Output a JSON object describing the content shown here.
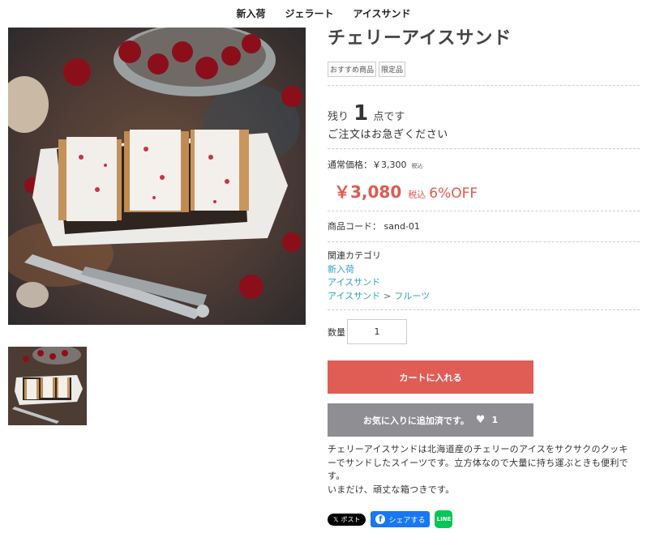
{
  "nav": {
    "items": [
      "新入荷",
      "ジェラート",
      "アイスサンド"
    ]
  },
  "product": {
    "title": "チェリーアイスサンド",
    "badges": [
      "おすすめ商品",
      "限定品"
    ],
    "stock_prefix": "残り",
    "stock_num": "1",
    "stock_suffix": "点です",
    "hurry": "ご注文はお急ぎください",
    "regular_price": "通常価格：￥3,300",
    "regular_tax": "税込",
    "sale_price": "￥3,080",
    "sale_tax": "税込",
    "discount": "6%OFF",
    "code": "商品コード： sand-01",
    "categories_label": "関連カテゴリ",
    "categories": [
      "新入荷",
      "アイスサンド"
    ],
    "category_path": [
      "アイスサンド",
      ">",
      "フルーツ"
    ],
    "qty_label": "数量",
    "qty_value": "1",
    "cart_button": "カートに入れる",
    "fav_button": "お気に入りに追加済です。",
    "fav_count": "1",
    "description": [
      "チェリーアイスサンドは北海道産のチェリーのアイスをサクサクのクッキ",
      "ーでサンドしたスイーツです。立方体なので大量に持ち運ぶときも便利で",
      "す。",
      "いまだけ、頑丈な箱つきです。"
    ],
    "social": {
      "x": "ポスト",
      "fb": "シェアする",
      "line": "LINE"
    }
  },
  "colors": {
    "accent": "#e05a50",
    "link": "#2aa0c8",
    "cart": "#e05d56",
    "fav": "#8e8e93"
  }
}
